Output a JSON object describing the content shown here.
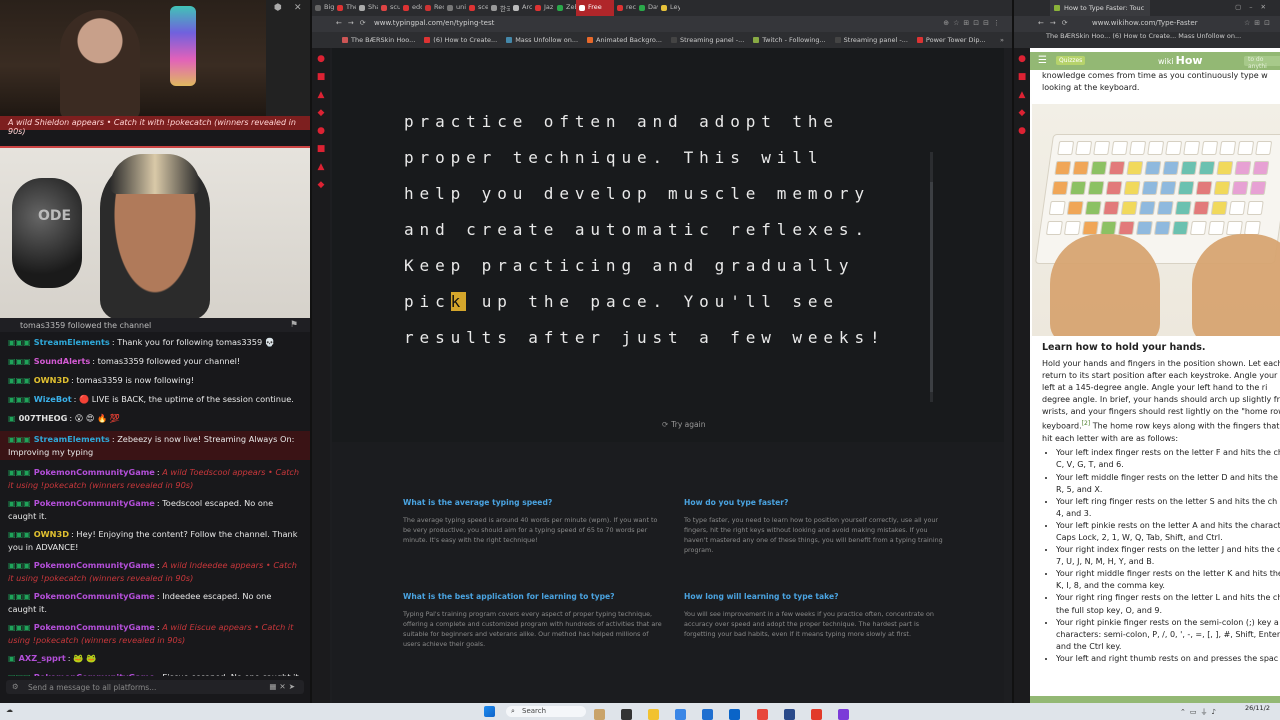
{
  "stream": {
    "cam_banner": "A wild Shieldon appears • Catch it with !pokecatch (winners revealed in 90s)",
    "mic_brand": "ODE",
    "pinned": "tomas3359 followed the channel",
    "chat": [
      {
        "badges": "▣▣▣",
        "user": "StreamElements",
        "color": "#2fa8d8",
        "text": "Thank you for following tomas3359 💀",
        "italic": false,
        "hl": false
      },
      {
        "badges": "▣▣▣",
        "user": "SoundAlerts",
        "color": "#d35ad3",
        "text": "tomas3359 followed your channel!",
        "italic": false,
        "hl": false
      },
      {
        "badges": "▣▣▣",
        "user": "OWN3D",
        "color": "#e0c030",
        "text": "tomas3359 is now following!",
        "italic": false,
        "hl": false
      },
      {
        "badges": "▣▣▣",
        "user": "WizeBot",
        "color": "#3ab0e8",
        "text": "🔴 LIVE is BACK, the uptime of the session continue.",
        "italic": false,
        "hl": false
      },
      {
        "badges": "▣",
        "user": "007THEOG",
        "color": "#e0e0e0",
        "text": "😮 😍 🔥 💯",
        "italic": false,
        "hl": false
      },
      {
        "badges": "▣▣▣",
        "user": "StreamElements",
        "color": "#2fa8d8",
        "text": "Zebeezy is now live! Streaming Always On: Improving my typing",
        "italic": false,
        "hl": true
      },
      {
        "badges": "▣▣▣",
        "user": "PokemonCommunityGame",
        "color": "#b34fd8",
        "text": "A wild Toedscool appears • Catch it using !pokecatch (winners revealed in 90s)",
        "italic": true,
        "hl": false
      },
      {
        "badges": "▣▣▣",
        "user": "PokemonCommunityGame",
        "color": "#b34fd8",
        "text": "Toedscool escaped. No one caught it.",
        "italic": false,
        "hl": false
      },
      {
        "badges": "▣▣▣",
        "user": "OWN3D",
        "color": "#e0c030",
        "text": "Hey! Enjoying the content? Follow the channel. Thank you in ADVANCE!",
        "italic": false,
        "hl": false
      },
      {
        "badges": "▣▣▣",
        "user": "PokemonCommunityGame",
        "color": "#b34fd8",
        "text": "A wild Indeedee appears • Catch it using !pokecatch (winners revealed in 90s)",
        "italic": true,
        "hl": false
      },
      {
        "badges": "▣▣▣",
        "user": "PokemonCommunityGame",
        "color": "#b34fd8",
        "text": "Indeedee escaped. No one caught it.",
        "italic": false,
        "hl": false
      },
      {
        "badges": "▣▣▣",
        "user": "PokemonCommunityGame",
        "color": "#b34fd8",
        "text": "A wild Eiscue appears • Catch it using !pokecatch (winners revealed in 90s)",
        "italic": true,
        "hl": false
      },
      {
        "badges": "▣",
        "user": "AXZ_spprt",
        "color": "#b34fd8",
        "text": "🐸 🐸",
        "italic": false,
        "hl": false
      },
      {
        "badges": "▣▣▣",
        "user": "PokemonCommunityGame",
        "color": "#b34fd8",
        "text": "Eiscue escaped. No one caught it.",
        "italic": false,
        "hl": false
      }
    ],
    "chat_placeholder": "Send a message to all platforms..."
  },
  "browser": {
    "url": "www.typingpal.com/en/typing-test",
    "tabs": [
      {
        "label": "Big",
        "c": "#666"
      },
      {
        "label": "The",
        "c": "#d33"
      },
      {
        "label": "Sha",
        "c": "#aaa"
      },
      {
        "label": "scu",
        "c": "#d44"
      },
      {
        "label": "edo",
        "c": "#d33"
      },
      {
        "label": "Rec",
        "c": "#c33"
      },
      {
        "label": "uni",
        "c": "#777"
      },
      {
        "label": "sce",
        "c": "#d33"
      },
      {
        "label": "한국",
        "c": "#999"
      },
      {
        "label": "Arc",
        "c": "#bbb"
      },
      {
        "label": "Jaz",
        "c": "#d33"
      },
      {
        "label": "Zeb",
        "c": "#2aa84a"
      },
      {
        "label": "Free",
        "c": "#fff",
        "active": true
      },
      {
        "label": "rec",
        "c": "#d33"
      },
      {
        "label": "Dav",
        "c": "#2aa84a"
      },
      {
        "label": "Ley",
        "c": "#e6c13a"
      }
    ],
    "bookmarks": [
      {
        "label": "The BÆRSkin Hoo...",
        "c": "#c55"
      },
      {
        "label": "(6) How to Create...",
        "c": "#d33"
      },
      {
        "label": "Mass Unfollow on...",
        "c": "#48a"
      },
      {
        "label": "Animated Backgro...",
        "c": "#e8682a"
      },
      {
        "label": "Streaming panel -...",
        "c": "#444"
      },
      {
        "label": "Twitch - Following...",
        "c": "#8a4"
      },
      {
        "label": "Streaming panel -...",
        "c": "#444"
      },
      {
        "label": "Power Tower Dip...",
        "c": "#d33"
      }
    ],
    "typing": {
      "lines": [
        "practice often and adopt the",
        "proper technique. This will",
        "help you develop muscle memory",
        "and create automatic reflexes.",
        "Keep practicing and gradually"
      ],
      "line6_before": "pic",
      "line6_cursor": "k",
      "line6_after": " up the pace. You'll see",
      "line7": "results after just a few weeks!",
      "try_again": "Try again"
    },
    "faq": [
      {
        "q": "What is the average typing speed?",
        "a": "The average typing speed is around 40 words per minute (wpm). If you want to be very productive, you should aim for a typing speed of 65 to 70 words per minute. It's easy with the right technique!"
      },
      {
        "q": "How do you type faster?",
        "a": "To type faster, you need to learn how to position yourself correctly, use all your fingers, hit the right keys without looking and avoid making mistakes. If you haven't mastered any one of these things, you will benefit from a typing training program."
      },
      {
        "q": "What is the best application for learning to type?",
        "a": "Typing Pal's training program covers every aspect of proper typing technique, offering a complete and customized program with hundreds of activities that are suitable for beginners and veterans alike. Our method has helped millions of users achieve their goals."
      },
      {
        "q": "How long will learning to type take?",
        "a": "You will see improvement in a few weeks if you practice often, concentrate on accuracy over speed and adopt the proper technique. The hardest part is forgetting your bad habits, even if it means typing more slowly at first."
      }
    ]
  },
  "wikihow": {
    "tab_title": "How to Type Faster: Touc",
    "url": "www.wikihow.com/Type-Faster",
    "bookmarks": "The BÆRSkin Hoo...   (6) How to Create...   Mass Unfollow on...",
    "badge": "Quizzes",
    "logo_wiki": "wiki",
    "logo_how": "How",
    "search_placeholder": "to do anythi",
    "intro": [
      "knowledge comes from time as you continuously type w",
      "looking at the keyboard."
    ],
    "heading": "Learn how to hold your hands.",
    "paragraph": "Hold your hands and fingers in the position shown. Let each return to its start position after each keystroke. Angle your r left at a 145-degree angle. Angle your left hand to the ri degree angle. In brief, your hands should arch up slightly fr wrists, and your fingers should rest lightly on the \"home row keyboard.",
    "sup": "[2]",
    "paragraph_tail": " The home row keys along with the fingers that hit each letter with are as follows:",
    "list": [
      "Your left index finger rests on the letter F and hits the ch C, V, G, T, and 6.",
      "Your left middle finger rests on the letter D and hits the D, R, 5, and X.",
      "Your left ring finger rests on the letter S and hits the ch E, 4, and 3.",
      "Your left pinkie rests on the letter A and hits the charact Caps Lock, 2, 1, W, Q, Tab, Shift, and Ctrl.",
      "Your right index finger rests on the letter J and hits the c 6, 7, U, J, N, M, H, Y, and B.",
      "Your right middle finger rests on the letter K and hits the K, I, 8, and the comma key.",
      "Your right ring finger rests on the letter L and hits the ch the full stop key, O, and 9.",
      "Your right pinkie finger rests on the semi-colon (;) key a characters: semi-colon, P, /, 0, ', -, =, [, ], #, Shift, Enter, and the Ctrl key.",
      "Your left and right thumb rests on and presses the spac"
    ]
  },
  "taskbar": {
    "search_label": "Search",
    "time": "",
    "date": "26/11/2"
  }
}
